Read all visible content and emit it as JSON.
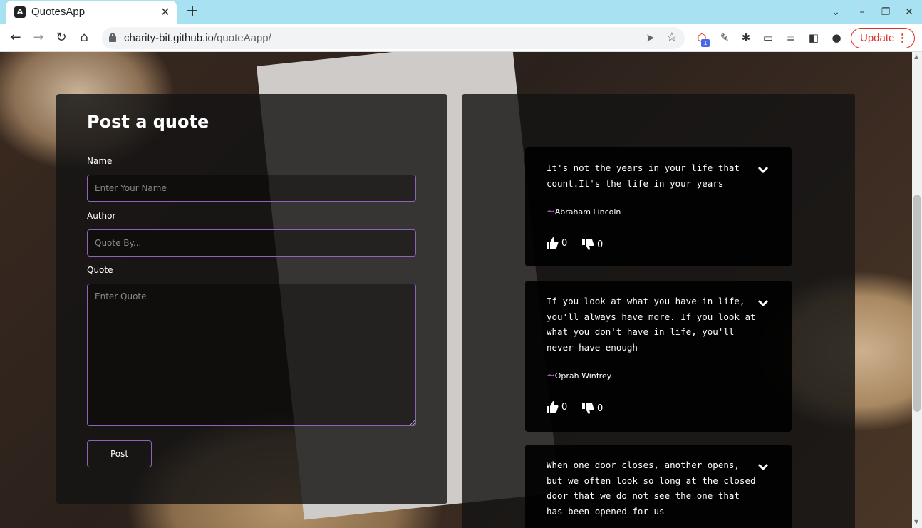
{
  "browser": {
    "tab_title": "QuotesApp",
    "url_host": "charity-bit.github.io",
    "url_path": "/quoteAapp/",
    "update_label": "Update",
    "extension_badge": "1"
  },
  "form": {
    "title": "Post a quote",
    "name_label": "Name",
    "name_placeholder": "Enter Your Name",
    "author_label": "Author",
    "author_placeholder": "Quote By...",
    "quote_label": "Quote",
    "quote_placeholder": "Enter Quote",
    "post_label": "Post"
  },
  "quotes": [
    {
      "text": "It's not the years in your life that count.It's the life in your years",
      "author": "Abraham Lincoln",
      "upvotes": "0",
      "downvotes": "0"
    },
    {
      "text": "If you look at what you have in life, you'll always have more. If you look at what you don't have in life, you'll never have enough",
      "author": "Oprah Winfrey",
      "upvotes": "0",
      "downvotes": "0"
    },
    {
      "text": "When one door closes, another opens, but we often look so long at the closed door that we do not see the one that has been opened for us",
      "author": "",
      "upvotes": "",
      "downvotes": ""
    }
  ],
  "colors": {
    "accent": "#8e63b8",
    "tilde": "#c56cf0",
    "update_red": "#d93025",
    "tab_strip": "#a8e1f2"
  }
}
